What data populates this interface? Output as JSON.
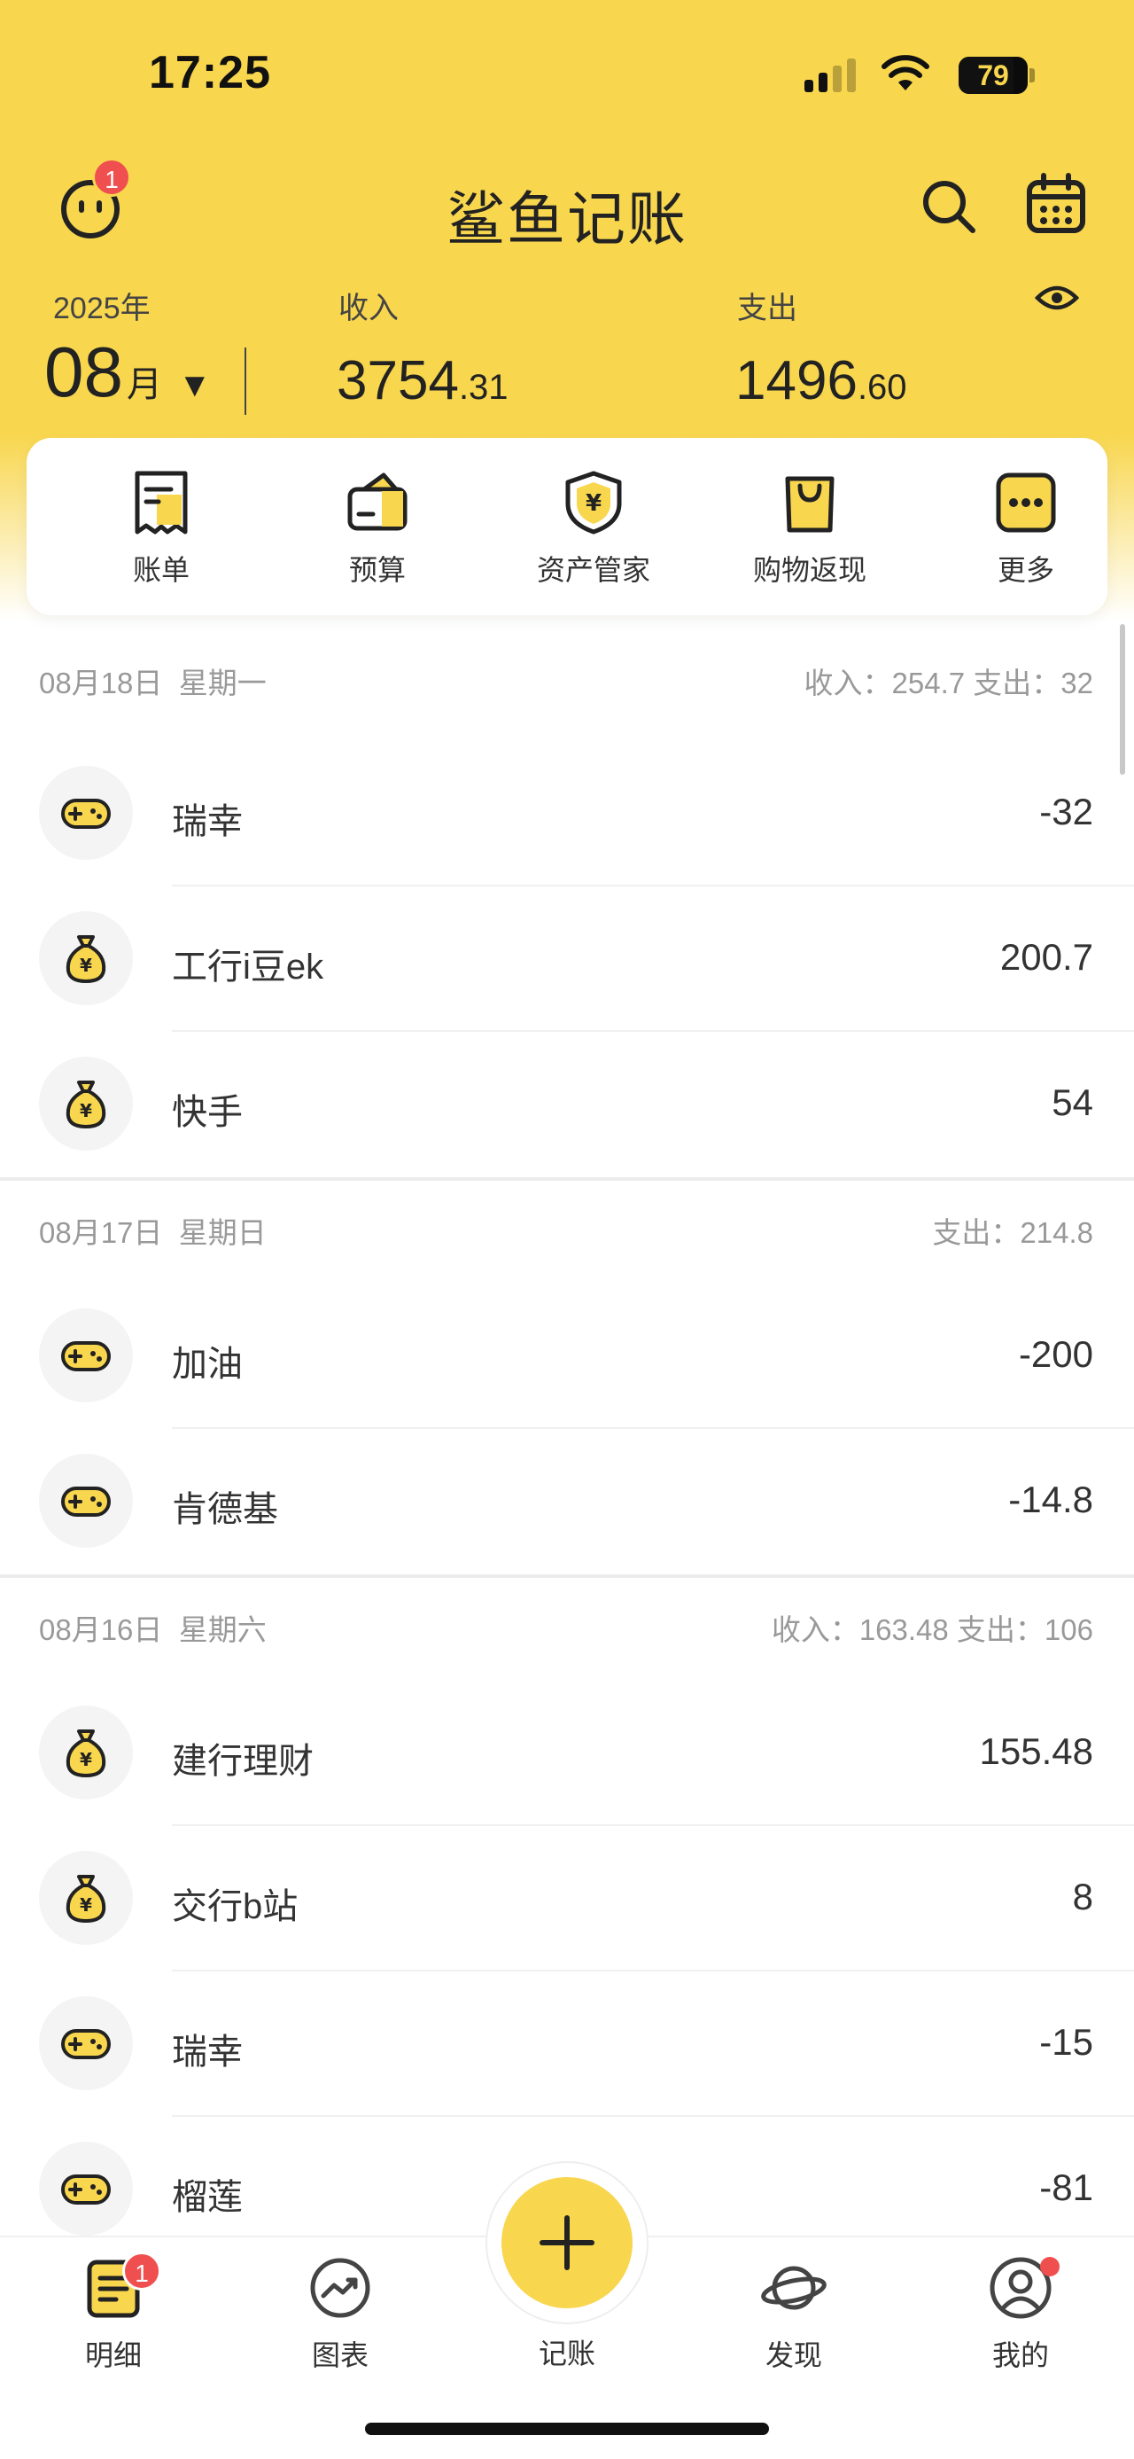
{
  "status_bar": {
    "time": "17:25",
    "battery": "79",
    "battery_level": 0.79
  },
  "header": {
    "title": "鲨鱼记账",
    "notification_count": "1"
  },
  "summary": {
    "year": "2025年",
    "month": "08",
    "month_unit": "月",
    "income_label": "收入",
    "income_int": "3754",
    "income_dec": ".31",
    "expense_label": "支出",
    "expense_int": "1496",
    "expense_dec": ".60"
  },
  "quick_menu": [
    {
      "label": "账单",
      "icon": "bill-icon"
    },
    {
      "label": "预算",
      "icon": "budget-wallet-icon"
    },
    {
      "label": "资产管家",
      "icon": "asset-shield-icon"
    },
    {
      "label": "购物返现",
      "icon": "shopping-bag-icon"
    },
    {
      "label": "更多",
      "icon": "more-icon"
    }
  ],
  "days": [
    {
      "date": "08月18日",
      "weekday": "星期一",
      "stats": "收入：254.7   支出：32",
      "rows": [
        {
          "label": "瑞幸",
          "amount": "-32",
          "icon": "gamepad-icon"
        },
        {
          "label": "工行i豆ek",
          "amount": "200.7",
          "icon": "money-bag-icon"
        },
        {
          "label": "快手",
          "amount": "54",
          "icon": "money-bag-icon"
        }
      ]
    },
    {
      "date": "08月17日",
      "weekday": "星期日",
      "stats": "支出：214.8",
      "rows": [
        {
          "label": "加油",
          "amount": "-200",
          "icon": "gamepad-icon"
        },
        {
          "label": "肯德基",
          "amount": "-14.8",
          "icon": "gamepad-icon"
        }
      ]
    },
    {
      "date": "08月16日",
      "weekday": "星期六",
      "stats": "收入：163.48   支出：106",
      "rows": [
        {
          "label": "建行理财",
          "amount": "155.48",
          "icon": "money-bag-icon"
        },
        {
          "label": "交行b站",
          "amount": "8",
          "icon": "money-bag-icon"
        },
        {
          "label": "瑞幸",
          "amount": "-15",
          "icon": "gamepad-icon"
        },
        {
          "label": "榴莲",
          "amount": "-81",
          "icon": "gamepad-icon"
        }
      ]
    }
  ],
  "bottom_nav": {
    "detail": "明细",
    "detail_badge": "1",
    "charts": "图表",
    "record": "记账",
    "discover": "发现",
    "mine": "我的"
  },
  "colors": {
    "brand": "#f8d64e",
    "badge": "#f04f4f"
  }
}
